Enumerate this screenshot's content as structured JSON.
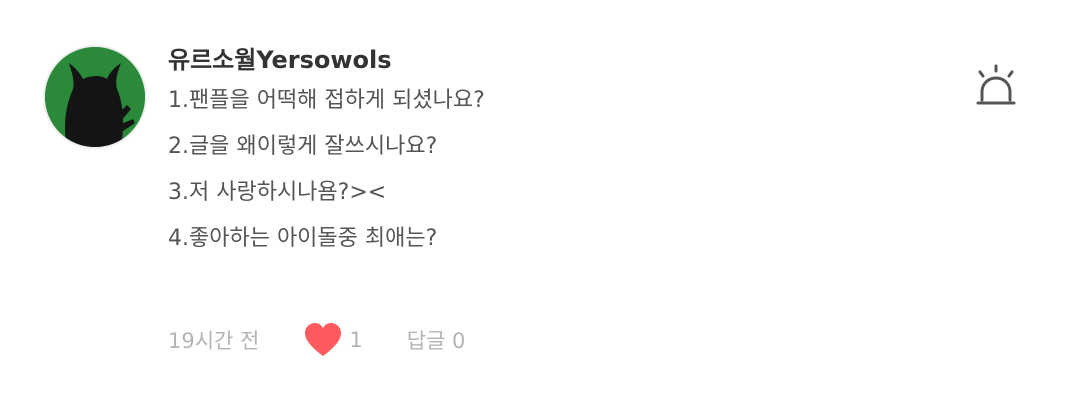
{
  "comment": {
    "author": "유르소월Yersowols",
    "lines": [
      "1.팬플을 어떡해 접하게 되셨나요?",
      "2.글을 왜이렇게 잘쓰시나요?",
      "3.저 사랑하시나욤?><",
      "4.좋아하는 아이돌중 최애는?"
    ],
    "time": "19시간 전",
    "like_count": "1",
    "reply_label": "답글 0",
    "icons": {
      "avatar": "avatar-image",
      "report": "siren-icon",
      "like": "heart-icon"
    },
    "colors": {
      "heart": "#ff5a5f",
      "avatar_bg": "#2a8a3a",
      "meta_text": "#b4b4b4"
    }
  }
}
